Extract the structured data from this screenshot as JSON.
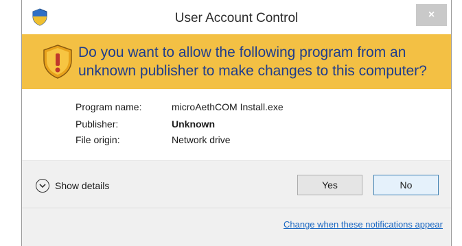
{
  "window": {
    "title": "User Account Control",
    "close_glyph": "×",
    "title_icon": "uac-shield-icon"
  },
  "banner": {
    "icon": "warning-shield-icon",
    "message": "Do you want to allow the following program from an unknown publisher to make changes to this computer?",
    "background_color": "#f3c044",
    "text_color": "#1f3d8c"
  },
  "details": {
    "rows": [
      {
        "label": "Program name:",
        "value": "microAethCOM Install.exe"
      },
      {
        "label": "Publisher:",
        "value": "Unknown"
      },
      {
        "label": "File origin:",
        "value": "Network drive"
      }
    ]
  },
  "footer": {
    "show_details_label": "Show details",
    "show_details_icon": "chevron-down-circle-icon",
    "yes_label": "Yes",
    "no_label": "No",
    "link_text": "Change when these notifications appear"
  }
}
